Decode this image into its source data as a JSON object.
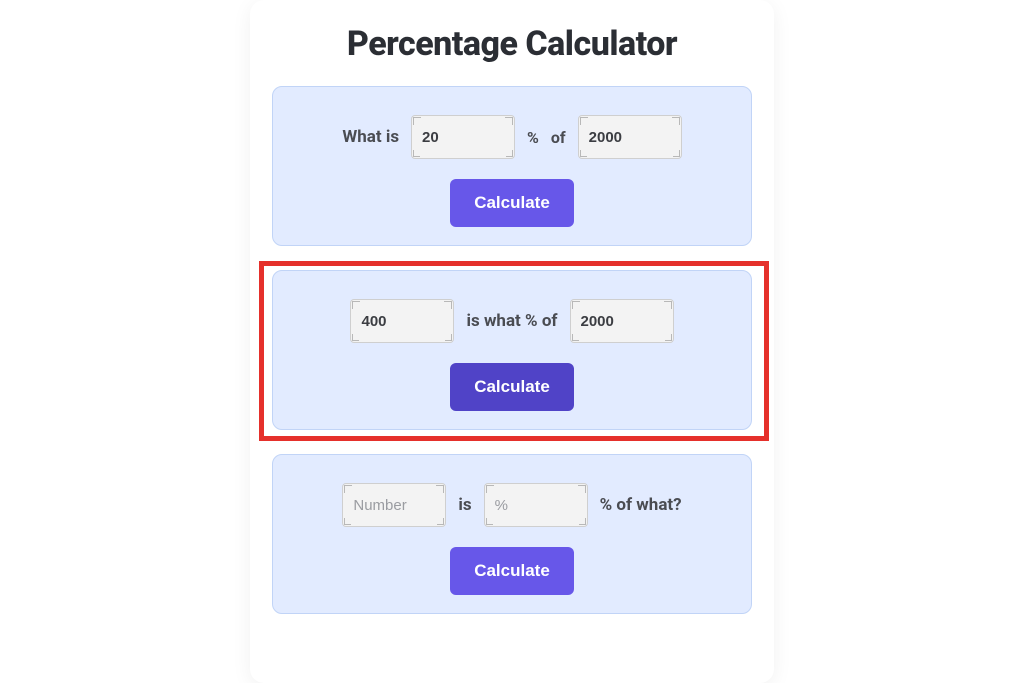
{
  "title": "Percentage Calculator",
  "sections": [
    {
      "label1": "What is",
      "value1": "20",
      "mid1": "%",
      "mid2": "of",
      "value2": "2000",
      "button": "Calculate",
      "highlighted": false,
      "buttonActive": false,
      "placeholder1": "",
      "placeholder2": ""
    },
    {
      "label1": "",
      "value1": "400",
      "mid1": "is what % of",
      "mid2": "",
      "value2": "2000",
      "button": "Calculate",
      "highlighted": true,
      "buttonActive": true,
      "placeholder1": "",
      "placeholder2": ""
    },
    {
      "label1": "",
      "value1": "",
      "mid1": "is",
      "mid2": "",
      "value2": "",
      "trailing": "% of what?",
      "button": "Calculate",
      "highlighted": false,
      "buttonActive": false,
      "placeholder1": "Number",
      "placeholder2": "%"
    }
  ]
}
